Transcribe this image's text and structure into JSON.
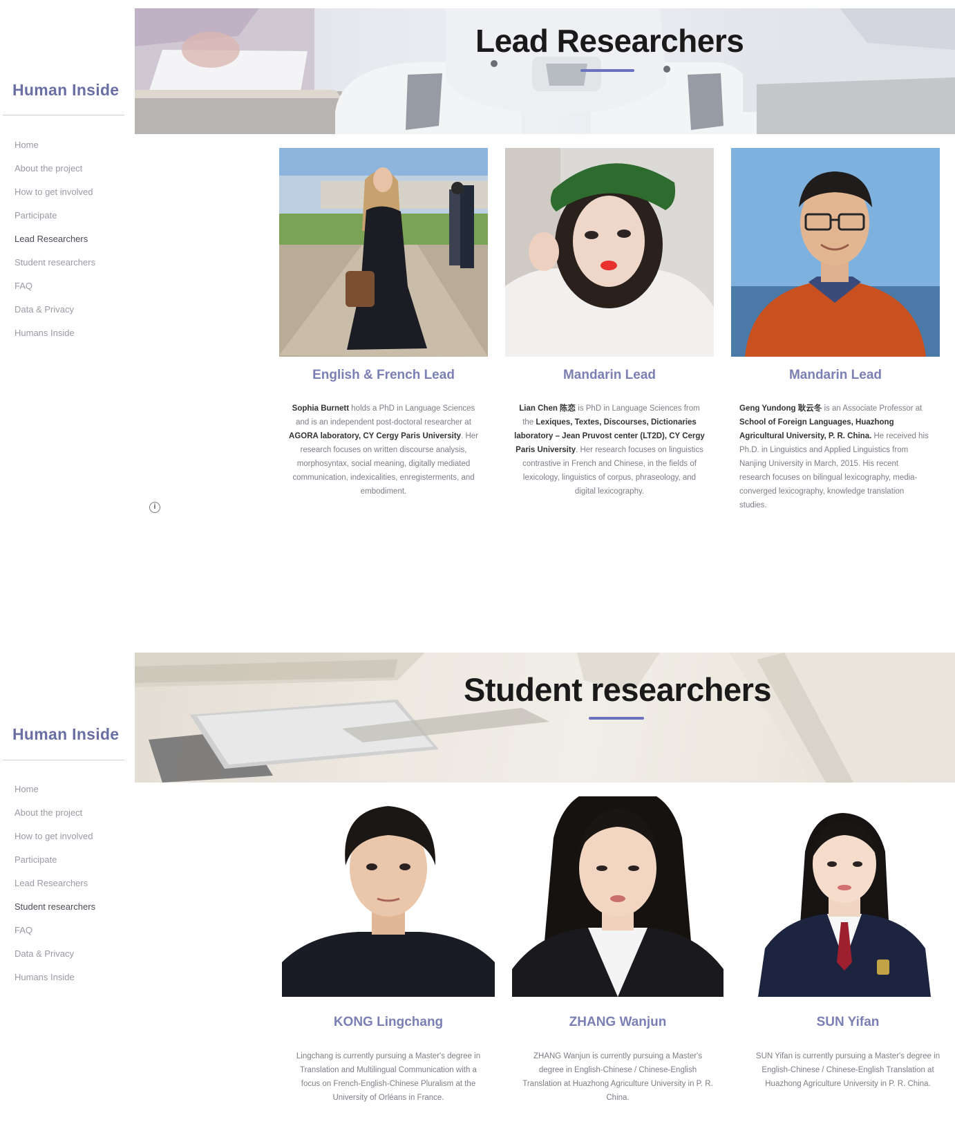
{
  "site": {
    "title": "Human Inside"
  },
  "nav": {
    "items": [
      "Home",
      "About the project",
      "How to get involved",
      "Participate",
      "Lead Researchers",
      "Student researchers",
      "FAQ",
      "Data & Privacy",
      "Humans Inside"
    ]
  },
  "lead": {
    "banner_title": "Lead Researchers",
    "active_index": 4,
    "cards": [
      {
        "role": "English & French Lead",
        "bio": [
          {
            "t": "Sophia Burnett",
            "b": true
          },
          {
            "t": " holds a PhD in Language Sciences and is an independent post-doctoral researcher at ",
            "b": false
          },
          {
            "t": "AGORA laboratory, CY Cergy Paris University",
            "b": true
          },
          {
            "t": ". Her research focuses on written discourse analysis, morphosyntax, social meaning, digitally mediated communication, indexicalities, enregisterments, and embodiment.",
            "b": false
          }
        ]
      },
      {
        "role": "Mandarin Lead",
        "bio": [
          {
            "t": "Lian Chen 陈恋",
            "b": true
          },
          {
            "t": "  is PhD in Language Sciences from the ",
            "b": false
          },
          {
            "t": "Lexiques, Textes, Discourses, Dictionaries laboratory – Jean Pruvost center (LT2D), CY Cergy Paris University",
            "b": true
          },
          {
            "t": ". Her research focuses on linguistics contrastive in French and Chinese, in the fields of lexicology, linguistics of corpus, phraseology, and digital lexicography.",
            "b": false
          }
        ]
      },
      {
        "role": "Mandarin Lead",
        "bio": [
          {
            "t": "Geng Yundong 耿云冬",
            "b": true
          },
          {
            "t": " is an Associate Professor at ",
            "b": false
          },
          {
            "t": "School of Foreign Languages, Huazhong Agricultural University, P. R. China.",
            "b": true
          },
          {
            "t": " He received his Ph.D. in Linguistics and Applied Linguistics from Nanjing University in March, 2015. His recent research focuses on bilingual lexicography, media-converged lexicography, knowledge translation studies.",
            "b": false
          }
        ]
      }
    ]
  },
  "student": {
    "banner_title": "Student researchers",
    "active_index": 5,
    "cards": [
      {
        "name": "KONG Lingchang",
        "bio": "Lingchang is currently pursuing a Master's degree in Translation and Multilingual Communication with a focus on French-English-Chinese Pluralism at the University of Orléans in France."
      },
      {
        "name": "ZHANG Wanjun",
        "bio": "ZHANG Wanjun is currently pursuing a Master's degree in English-Chinese / Chinese-English Translation at Huazhong Agriculture University in P. R. China."
      },
      {
        "name": "SUN Yifan",
        "bio": "SUN Yifan is currently pursuing a Master's degree in English-Chinese / Chinese-English Translation at Huazhong Agriculture University in P. R. China."
      }
    ]
  },
  "icons": {
    "info": "info-icon"
  },
  "colors": {
    "accent": "#6a72c0",
    "site_title": "#6a6fa3",
    "card_title": "#7a80b4",
    "nav_text": "#9a9aa4",
    "nav_active": "#4a4a55"
  }
}
